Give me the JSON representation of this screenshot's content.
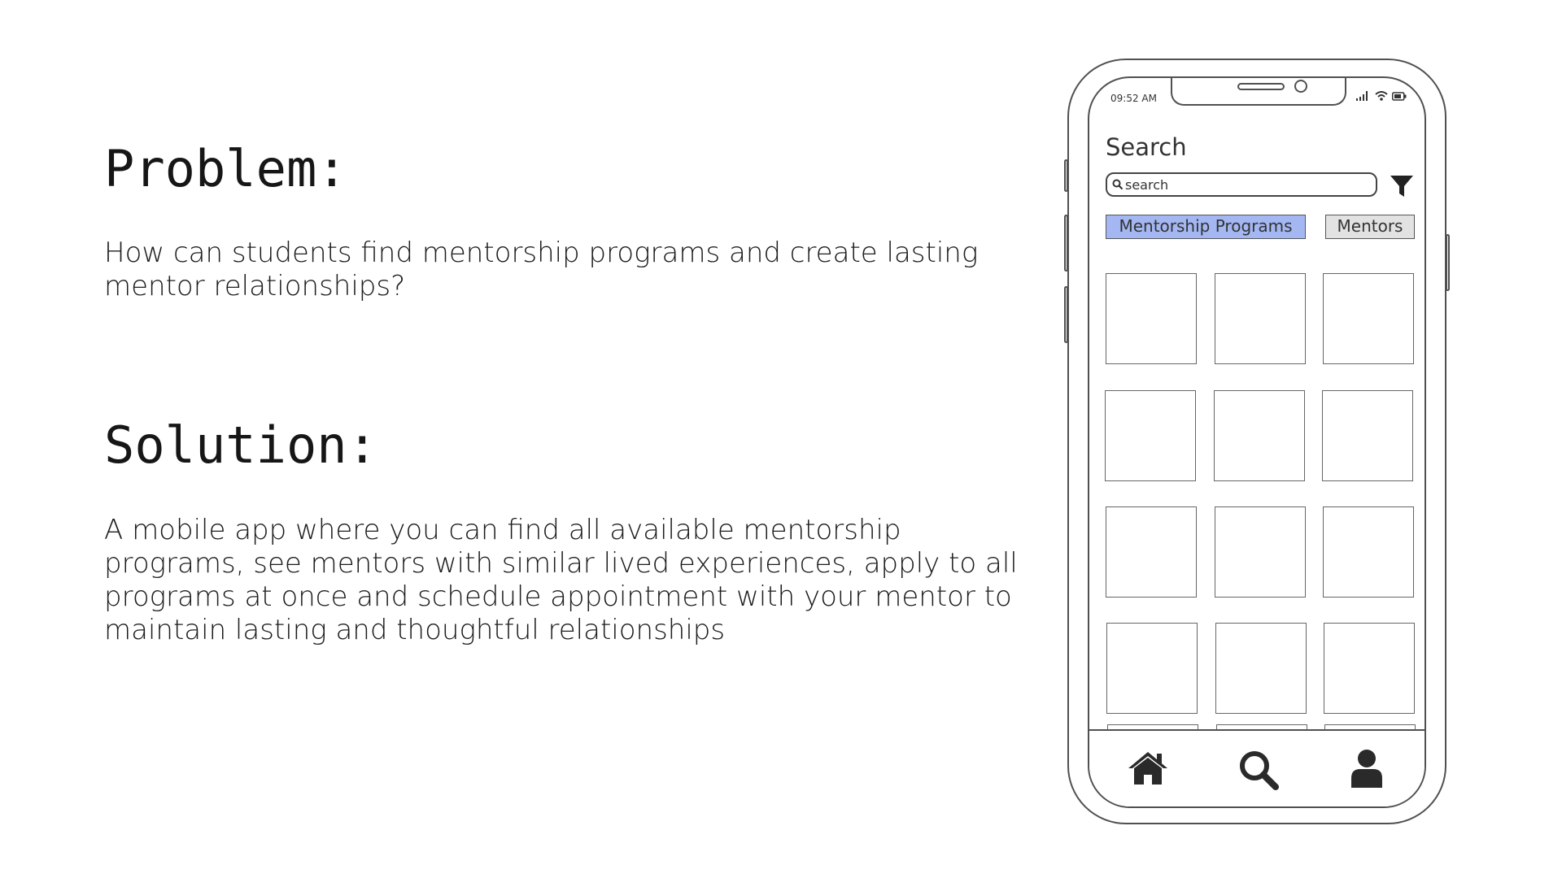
{
  "problem": {
    "heading": "Problem:",
    "text": "How can students find mentorship programs and create lasting mentor relationships?"
  },
  "solution": {
    "heading": "Solution:",
    "text": "A mobile app where you can find all available mentorship programs, see mentors with similar lived experiences, apply to all programs at once and schedule appointment with your mentor to maintain lasting and thoughtful relationships"
  },
  "phone": {
    "status_time": "09:52 AM",
    "title": "Search",
    "search": {
      "placeholder": "search"
    },
    "tabs": [
      {
        "label": "Mentorship Programs",
        "selected": true,
        "color": "#a4b7f2"
      },
      {
        "label": "Mentors",
        "selected": false,
        "color": "#e2e2e2"
      }
    ],
    "nav": [
      {
        "icon": "home-icon"
      },
      {
        "icon": "search-icon"
      },
      {
        "icon": "profile-icon"
      }
    ]
  }
}
